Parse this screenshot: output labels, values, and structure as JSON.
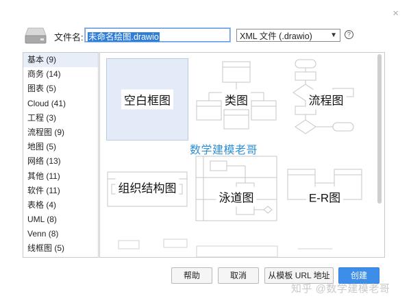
{
  "dialog": {
    "close_glyph": "×",
    "header_icon": "storage-drive-icon",
    "filename_label": "文件名:",
    "filename_value": "未命名绘图.drawio",
    "format_value": "XML 文件 (.drawio)",
    "help_glyph": "?"
  },
  "categories": [
    {
      "label": "基本 (9)"
    },
    {
      "label": "商务 (14)"
    },
    {
      "label": "图表 (5)"
    },
    {
      "label": "Cloud (41)"
    },
    {
      "label": "工程 (3)"
    },
    {
      "label": "流程图 (9)"
    },
    {
      "label": "地图 (5)"
    },
    {
      "label": "网络 (13)"
    },
    {
      "label": "其他 (11)"
    },
    {
      "label": "软件 (11)"
    },
    {
      "label": "表格 (4)"
    },
    {
      "label": "UML (8)"
    },
    {
      "label": "Venn (8)"
    },
    {
      "label": "线框图 (5)"
    }
  ],
  "templates": [
    {
      "label": "空白框图"
    },
    {
      "label": "类图"
    },
    {
      "label": "流程图"
    },
    {
      "label": "组织结构图"
    },
    {
      "label": "泳道图"
    },
    {
      "label": "E-R图"
    }
  ],
  "watermark_center": "数学建模老哥",
  "buttons": {
    "help": "帮助",
    "cancel": "取消",
    "from_url": "从模板 URL 地址",
    "create": "创建"
  },
  "watermark_corner": "知乎 @数学建模老哥",
  "colors": {
    "accent": "#3d8ee8",
    "selection": "#2f7ed8",
    "selected_tile": "#e2ebf7",
    "watermark": "#2d8fd5"
  }
}
